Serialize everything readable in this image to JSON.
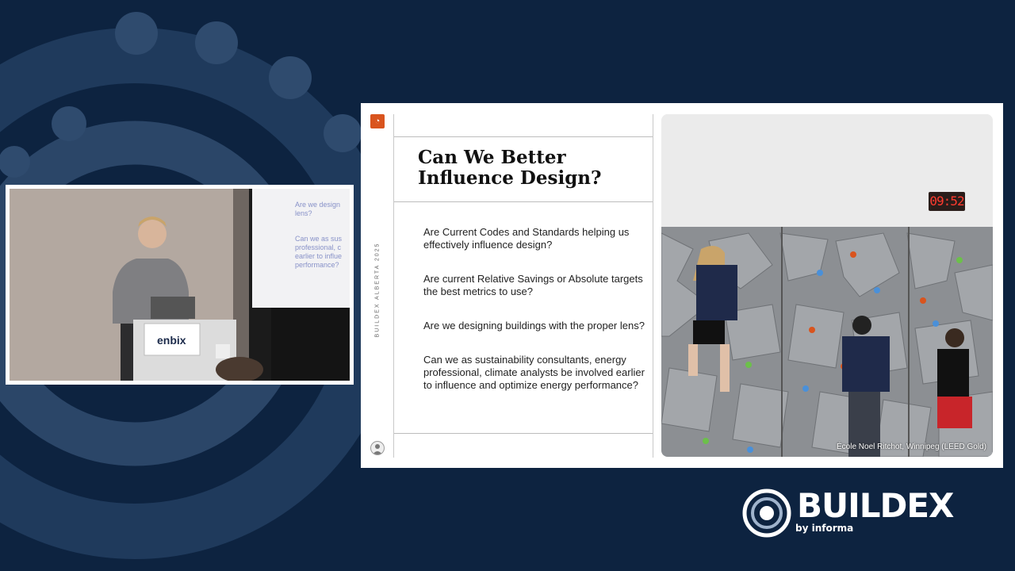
{
  "slide": {
    "title": "Can We Better Influence Design?",
    "vertical_brand": "BUILDEX ALBERTA 2025",
    "bullets": [
      "Are Current Codes and Standards helping us effectively influence design?",
      "Are current Relative Savings or Absolute targets the best metrics to use?",
      "Are we designing buildings with the proper lens?",
      "Can we as sustainability consultants, energy professional, climate analysts be involved earlier to influence and optimize energy performance?"
    ],
    "photo_caption": "École Noel Ritchot, Winnipeg (LEED Gold)",
    "timer_display": "09:52"
  },
  "video": {
    "podium_label": "enbix",
    "screen_text_1": "Are we design lens?",
    "screen_text_2": "Can we as sus professional, c earlier to influe performance?"
  },
  "brand": {
    "name": "BUILDEX",
    "sub": "by informa"
  },
  "colors": {
    "background": "#0d2340",
    "accent_orange": "#d9541e",
    "ring_color": "#2b4668"
  },
  "icons": [
    "buildex-logo-icon",
    "slide-logo-icon",
    "presenter-avatar-icon"
  ]
}
